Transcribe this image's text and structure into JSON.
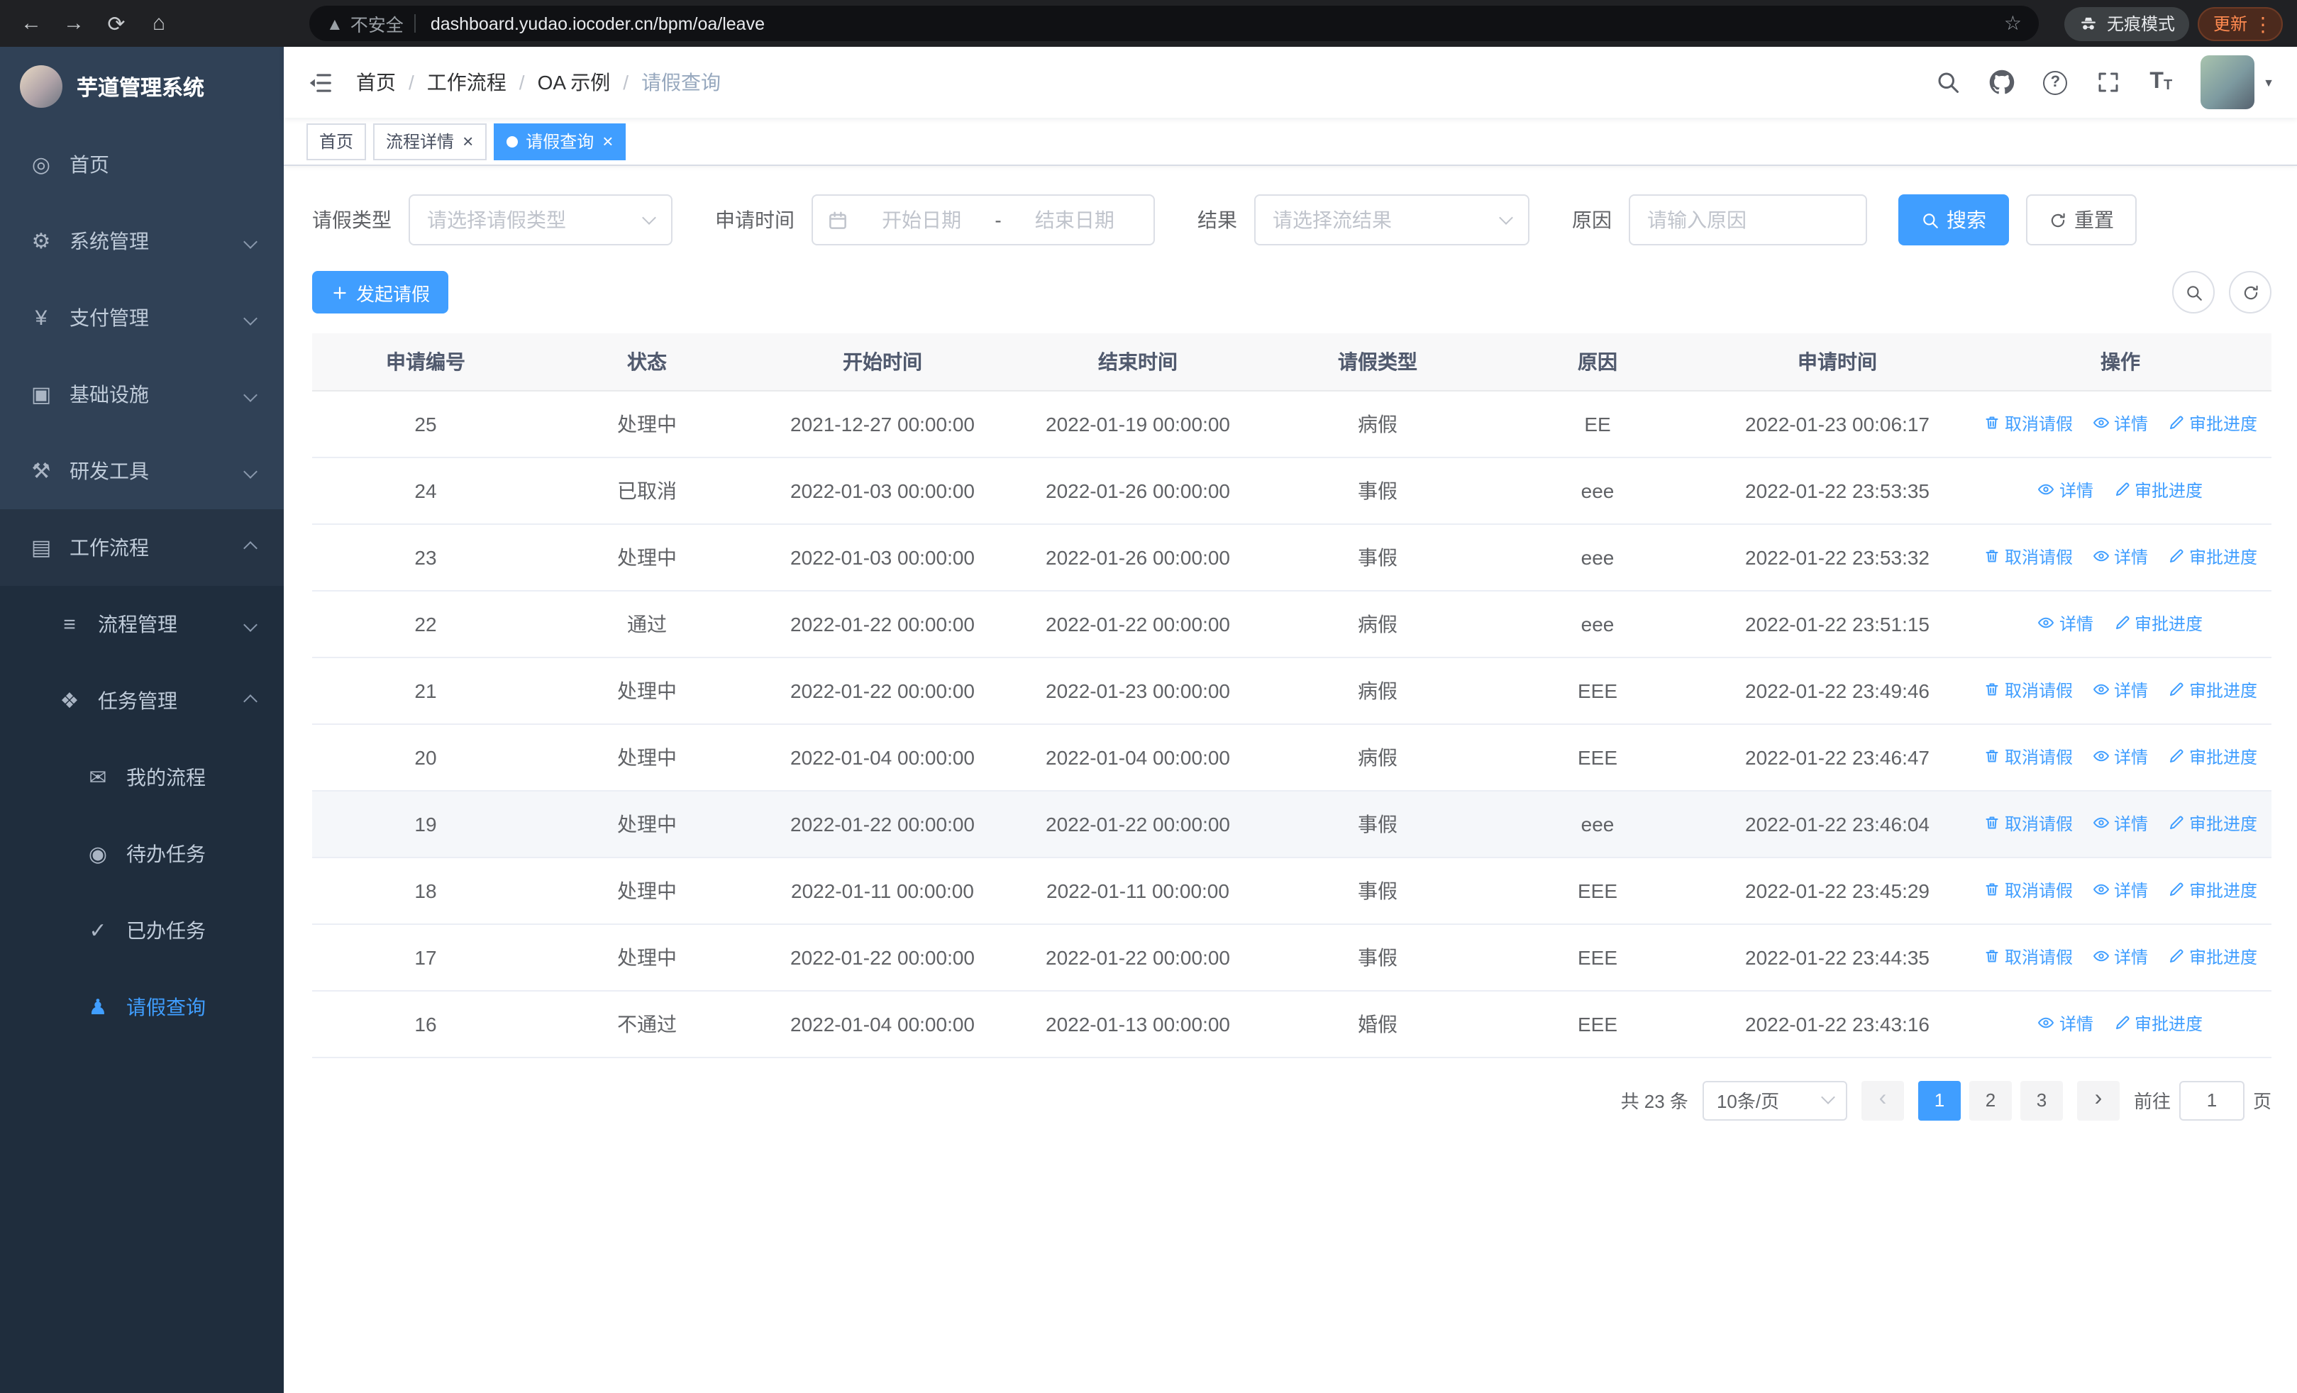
{
  "colors": {
    "primary": "#409EFF",
    "sidebar_bg": "#304156",
    "sidebar_submenu_bg": "#1f2d3d",
    "table_header_bg": "#f8f8f9"
  },
  "browser": {
    "security_label": "不安全",
    "url": "dashboard.yudao.iocoder.cn/bpm/oa/leave",
    "incognito_label": "无痕模式",
    "update_label": "更新"
  },
  "sidebar": {
    "app_title": "芋道管理系统",
    "items": [
      {
        "id": "home",
        "label": "首页",
        "icon": "home-icon",
        "level": 1
      },
      {
        "id": "system",
        "label": "系统管理",
        "icon": "gear-icon",
        "level": 1,
        "chevron": "down"
      },
      {
        "id": "payment",
        "label": "支付管理",
        "icon": "yen-icon",
        "level": 1,
        "chevron": "down"
      },
      {
        "id": "infrastructure",
        "label": "基础设施",
        "icon": "infra-icon",
        "level": 1,
        "chevron": "down"
      },
      {
        "id": "devtools",
        "label": "研发工具",
        "icon": "tools-icon",
        "level": 1,
        "chevron": "down"
      },
      {
        "id": "workflow",
        "label": "工作流程",
        "icon": "workflow-icon",
        "level": 1,
        "chevron": "up",
        "expanded": true
      },
      {
        "id": "process-mgmt",
        "label": "流程管理",
        "icon": "process-icon",
        "level": 2,
        "chevron": "down"
      },
      {
        "id": "task-mgmt",
        "label": "任务管理",
        "icon": "task-icon",
        "level": 2,
        "chevron": "up"
      },
      {
        "id": "my-process",
        "label": "我的流程",
        "icon": "chat-icon",
        "level": 3
      },
      {
        "id": "todo-tasks",
        "label": "待办任务",
        "icon": "eye-icon",
        "level": 3
      },
      {
        "id": "done-tasks",
        "label": "已办任务",
        "icon": "check-icon",
        "level": 3
      },
      {
        "id": "leave-query",
        "label": "请假查询",
        "icon": "user-icon",
        "level": 3,
        "active": true
      }
    ]
  },
  "navbar": {
    "breadcrumb": [
      "首页",
      "工作流程",
      "OA 示例",
      "请假查询"
    ],
    "separator": "/"
  },
  "tabs": [
    {
      "id": "home",
      "label": "首页",
      "closable": false,
      "active": false
    },
    {
      "id": "process-detail",
      "label": "流程详情",
      "closable": true,
      "active": false
    },
    {
      "id": "leave-query",
      "label": "请假查询",
      "closable": true,
      "active": true
    }
  ],
  "filters": {
    "leave_type_label": "请假类型",
    "leave_type_placeholder": "请选择请假类型",
    "apply_time_label": "申请时间",
    "start_date_placeholder": "开始日期",
    "range_separator": "-",
    "end_date_placeholder": "结束日期",
    "result_label": "结果",
    "result_placeholder": "请选择流结果",
    "reason_label": "原因",
    "reason_placeholder": "请输入原因",
    "search_button": "搜索",
    "reset_button": "重置"
  },
  "toolbar": {
    "create_button": "发起请假"
  },
  "table": {
    "columns": [
      "申请编号",
      "状态",
      "开始时间",
      "结束时间",
      "请假类型",
      "原因",
      "申请时间",
      "操作"
    ],
    "column_keys": [
      "id",
      "status",
      "start",
      "end",
      "type",
      "reason",
      "applied",
      "actions"
    ],
    "action_labels": {
      "cancel": "取消请假",
      "detail": "详情",
      "progress": "审批进度"
    },
    "rows": [
      {
        "id": "25",
        "status": "处理中",
        "start": "2021-12-27 00:00:00",
        "end": "2022-01-19 00:00:00",
        "type": "病假",
        "reason": "EE",
        "applied": "2022-01-23 00:06:17",
        "actions": [
          "cancel",
          "detail",
          "progress"
        ]
      },
      {
        "id": "24",
        "status": "已取消",
        "start": "2022-01-03 00:00:00",
        "end": "2022-01-26 00:00:00",
        "type": "事假",
        "reason": "eee",
        "applied": "2022-01-22 23:53:35",
        "actions": [
          "detail",
          "progress"
        ]
      },
      {
        "id": "23",
        "status": "处理中",
        "start": "2022-01-03 00:00:00",
        "end": "2022-01-26 00:00:00",
        "type": "事假",
        "reason": "eee",
        "applied": "2022-01-22 23:53:32",
        "actions": [
          "cancel",
          "detail",
          "progress"
        ]
      },
      {
        "id": "22",
        "status": "通过",
        "start": "2022-01-22 00:00:00",
        "end": "2022-01-22 00:00:00",
        "type": "病假",
        "reason": "eee",
        "applied": "2022-01-22 23:51:15",
        "actions": [
          "detail",
          "progress"
        ]
      },
      {
        "id": "21",
        "status": "处理中",
        "start": "2022-01-22 00:00:00",
        "end": "2022-01-23 00:00:00",
        "type": "病假",
        "reason": "EEE",
        "applied": "2022-01-22 23:49:46",
        "actions": [
          "cancel",
          "detail",
          "progress"
        ]
      },
      {
        "id": "20",
        "status": "处理中",
        "start": "2022-01-04 00:00:00",
        "end": "2022-01-04 00:00:00",
        "type": "病假",
        "reason": "EEE",
        "applied": "2022-01-22 23:46:47",
        "actions": [
          "cancel",
          "detail",
          "progress"
        ]
      },
      {
        "id": "19",
        "status": "处理中",
        "start": "2022-01-22 00:00:00",
        "end": "2022-01-22 00:00:00",
        "type": "事假",
        "reason": "eee",
        "applied": "2022-01-22 23:46:04",
        "actions": [
          "cancel",
          "detail",
          "progress"
        ],
        "highlighted": true
      },
      {
        "id": "18",
        "status": "处理中",
        "start": "2022-01-11 00:00:00",
        "end": "2022-01-11 00:00:00",
        "type": "事假",
        "reason": "EEE",
        "applied": "2022-01-22 23:45:29",
        "actions": [
          "cancel",
          "detail",
          "progress"
        ]
      },
      {
        "id": "17",
        "status": "处理中",
        "start": "2022-01-22 00:00:00",
        "end": "2022-01-22 00:00:00",
        "type": "事假",
        "reason": "EEE",
        "applied": "2022-01-22 23:44:35",
        "actions": [
          "cancel",
          "detail",
          "progress"
        ]
      },
      {
        "id": "16",
        "status": "不通过",
        "start": "2022-01-04 00:00:00",
        "end": "2022-01-13 00:00:00",
        "type": "婚假",
        "reason": "EEE",
        "applied": "2022-01-22 23:43:16",
        "actions": [
          "detail",
          "progress"
        ]
      }
    ]
  },
  "pagination": {
    "total_text": "共 23 条",
    "page_size_value": "10条/页",
    "pages": [
      "1",
      "2",
      "3"
    ],
    "active_page": "1",
    "goto_label": "前往",
    "goto_value": "1",
    "goto_suffix": "页"
  }
}
